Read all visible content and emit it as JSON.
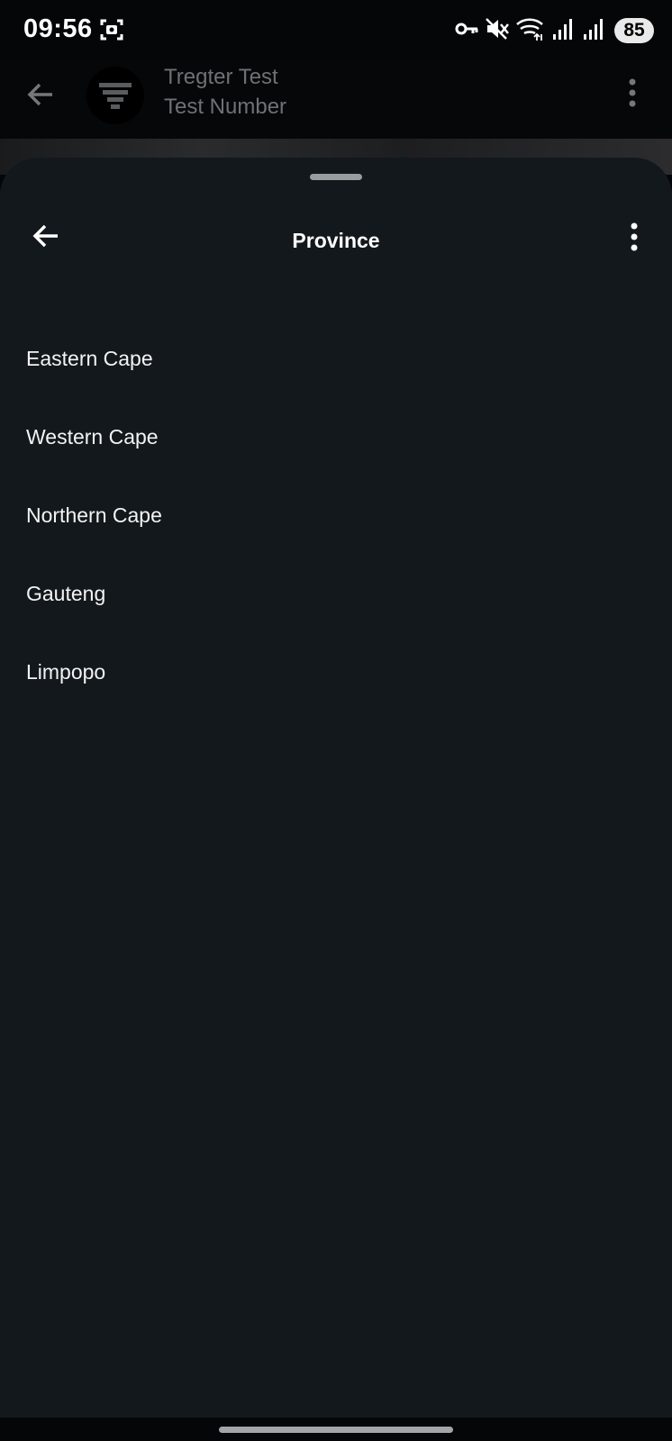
{
  "status_bar": {
    "time": "09:56",
    "battery": "85",
    "icons": [
      "screenshot-icon",
      "vpn-key-icon",
      "mute-icon",
      "wifi-icon",
      "signal-icon",
      "signal-icon"
    ]
  },
  "chat_header": {
    "name": "Tregter Test",
    "subtitle": "Test Number"
  },
  "sheet": {
    "title": "Province",
    "items": [
      {
        "label": "Eastern Cape"
      },
      {
        "label": "Western Cape"
      },
      {
        "label": "Northern Cape"
      },
      {
        "label": "Gauteng"
      },
      {
        "label": "Limpopo"
      }
    ]
  },
  "colors": {
    "sheet_background": "#13181c",
    "text": "#ffffff",
    "dimmed_text": "#6e7174"
  }
}
